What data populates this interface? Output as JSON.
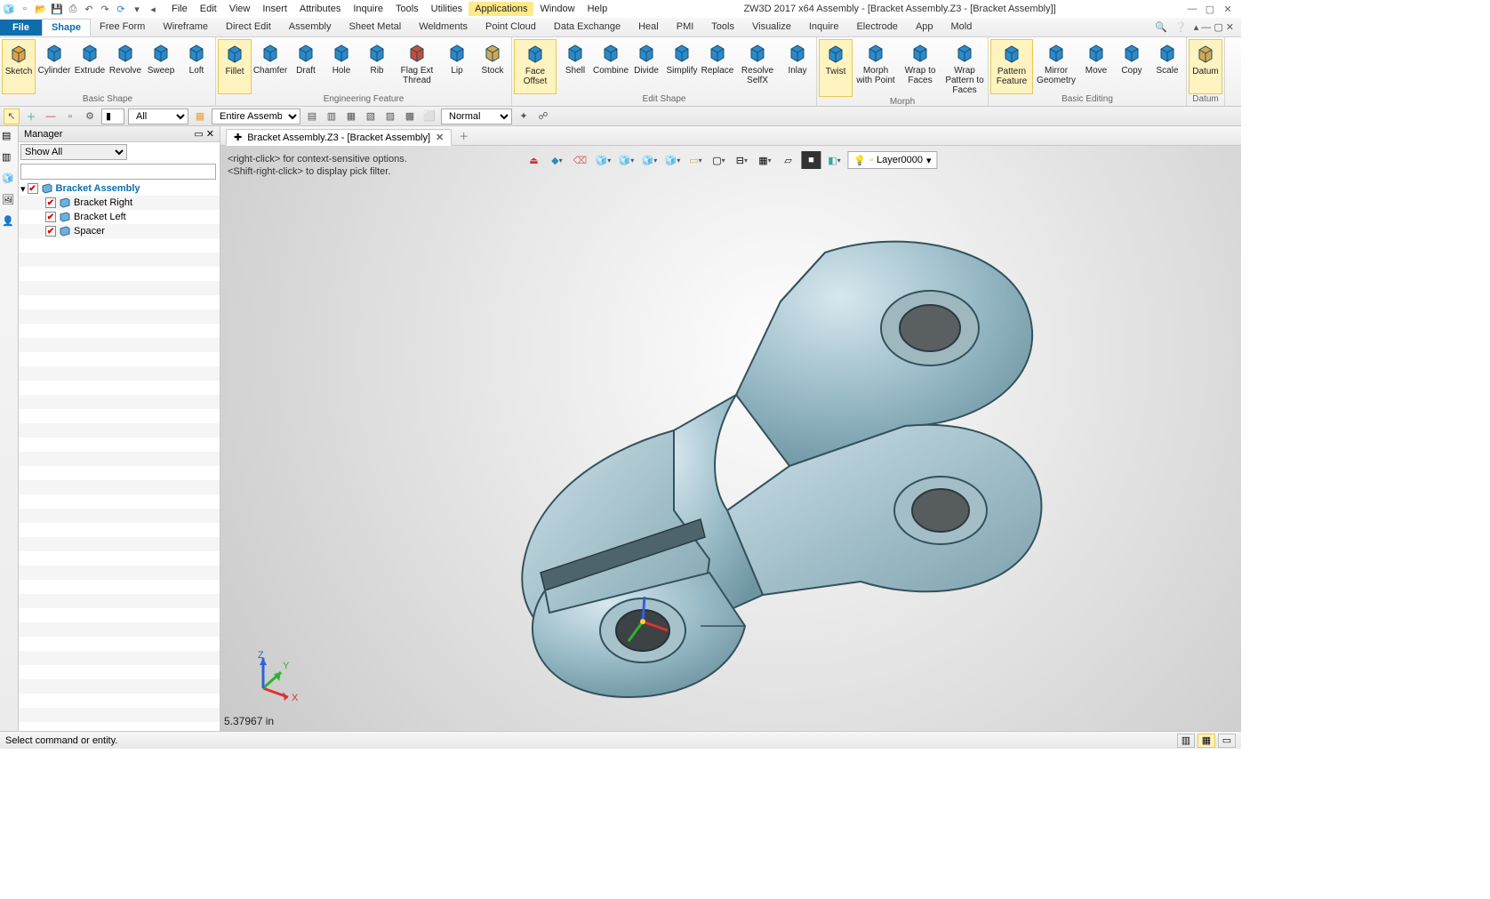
{
  "app": {
    "title": "ZW3D 2017  x64       Assembly - [Bracket Assembly.Z3 - [Bracket Assembly]]"
  },
  "menubar": {
    "items": [
      "File",
      "Edit",
      "View",
      "Insert",
      "Attributes",
      "Inquire",
      "Tools",
      "Utilities",
      "Applications",
      "Window",
      "Help"
    ],
    "highlight_index": 8
  },
  "ribbon_tabs": {
    "file": "File",
    "items": [
      "Shape",
      "Free Form",
      "Wireframe",
      "Direct Edit",
      "Assembly",
      "Sheet Metal",
      "Weldments",
      "Point Cloud",
      "Data Exchange",
      "Heal",
      "PMI",
      "Tools",
      "Visualize",
      "Inquire",
      "Electrode",
      "App",
      "Mold"
    ],
    "active_index": 0
  },
  "ribbon_groups": [
    {
      "label": "Basic Shape",
      "tools": [
        {
          "name": "sketch",
          "label": "Sketch",
          "color": "#e8a13a"
        },
        {
          "name": "cylinder",
          "label": "Cylinder",
          "color": "#2a8acb"
        },
        {
          "name": "extrude",
          "label": "Extrude",
          "color": "#2a8acb"
        },
        {
          "name": "revolve",
          "label": "Revolve",
          "color": "#2a8acb"
        },
        {
          "name": "sweep",
          "label": "Sweep",
          "color": "#2a8acb"
        },
        {
          "name": "loft",
          "label": "Loft",
          "color": "#2a8acb"
        }
      ]
    },
    {
      "label": "Engineering Feature",
      "tools": [
        {
          "name": "fillet",
          "label": "Fillet",
          "color": "#2a8acb"
        },
        {
          "name": "chamfer",
          "label": "Chamfer",
          "color": "#2a8acb"
        },
        {
          "name": "draft",
          "label": "Draft",
          "color": "#2a8acb"
        },
        {
          "name": "hole",
          "label": "Hole",
          "color": "#2a8acb"
        },
        {
          "name": "rib",
          "label": "Rib",
          "color": "#2a8acb"
        },
        {
          "name": "flag-ext-thread",
          "label": "Flag Ext Thread",
          "color": "#c94b3a"
        },
        {
          "name": "lip",
          "label": "Lip",
          "color": "#2a8acb"
        },
        {
          "name": "stock",
          "label": "Stock",
          "color": "#d4a94d"
        }
      ]
    },
    {
      "label": "Edit Shape",
      "tools": [
        {
          "name": "face-offset",
          "label": "Face Offset",
          "color": "#2a8acb"
        },
        {
          "name": "shell",
          "label": "Shell",
          "color": "#2a8acb"
        },
        {
          "name": "combine",
          "label": "Combine",
          "color": "#2a8acb"
        },
        {
          "name": "divide",
          "label": "Divide",
          "color": "#2a8acb"
        },
        {
          "name": "simplify",
          "label": "Simplify",
          "color": "#2a8acb"
        },
        {
          "name": "replace",
          "label": "Replace",
          "color": "#2a8acb"
        },
        {
          "name": "resolve-selfx",
          "label": "Resolve SelfX",
          "color": "#2a8acb"
        },
        {
          "name": "inlay",
          "label": "Inlay",
          "color": "#2a8acb"
        }
      ]
    },
    {
      "label": "Morph",
      "tools": [
        {
          "name": "twist",
          "label": "Twist",
          "color": "#2a8acb"
        },
        {
          "name": "morph-with-point",
          "label": "Morph with Point",
          "color": "#2a8acb"
        },
        {
          "name": "wrap-to-faces",
          "label": "Wrap to Faces",
          "color": "#2a8acb"
        },
        {
          "name": "wrap-pattern-to-faces",
          "label": "Wrap Pattern to Faces",
          "color": "#2a8acb"
        }
      ]
    },
    {
      "label": "Basic Editing",
      "tools": [
        {
          "name": "pattern-feature",
          "label": "Pattern Feature",
          "color": "#2a8acb"
        },
        {
          "name": "mirror-geometry",
          "label": "Mirror Geometry",
          "color": "#2a8acb"
        },
        {
          "name": "move",
          "label": "Move",
          "color": "#2a8acb"
        },
        {
          "name": "copy",
          "label": "Copy",
          "color": "#2a8acb"
        },
        {
          "name": "scale",
          "label": "Scale",
          "color": "#2a8acb"
        }
      ]
    },
    {
      "label": "Datum",
      "tools": [
        {
          "name": "datum",
          "label": "Datum",
          "color": "#d4a94d"
        }
      ]
    }
  ],
  "filterbar": {
    "filter1": "All",
    "filter2": "Entire Assembly",
    "mode": "Normal"
  },
  "manager": {
    "title": "Manager",
    "show": "Show All",
    "tree_root": "Bracket Assembly",
    "children": [
      {
        "name": "Bracket Right",
        "checked": true
      },
      {
        "name": "Bracket Left",
        "checked": true
      },
      {
        "name": "Spacer",
        "checked": true
      }
    ]
  },
  "doctabs": {
    "active": "Bracket Assembly.Z3 - [Bracket Assembly]"
  },
  "viewport": {
    "hint1": "<right-click> for context-sensitive options.",
    "hint2": "<Shift-right-click> to display pick filter.",
    "layer": "Layer0000",
    "measure": "5.37967 in",
    "axes": {
      "x": "X",
      "y": "Y",
      "z": "Z"
    }
  },
  "status": {
    "prompt": "Select command or entity."
  }
}
